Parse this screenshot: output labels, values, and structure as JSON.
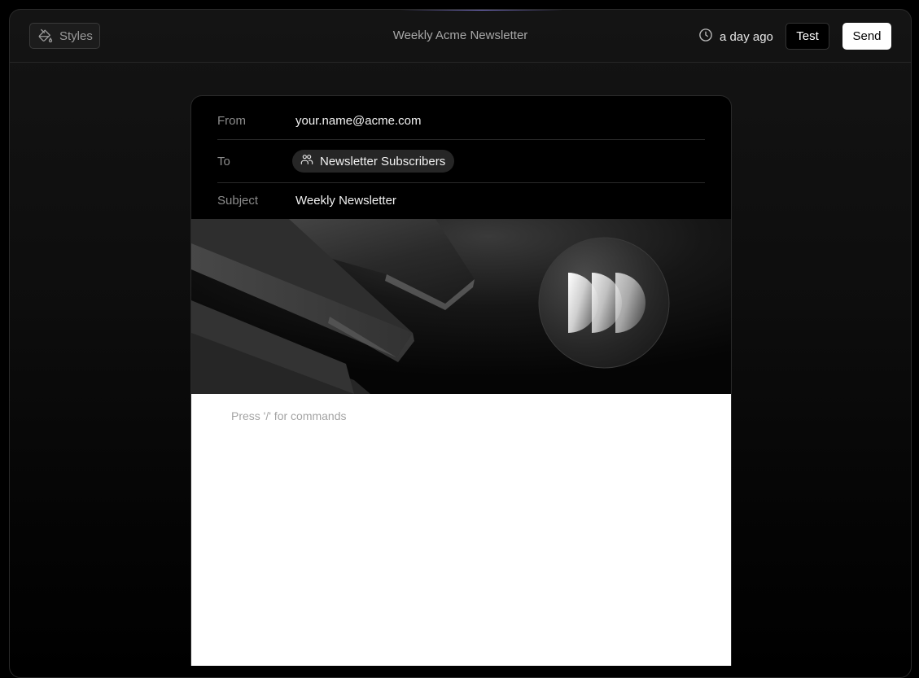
{
  "toolbar": {
    "styles_label": "Styles",
    "title": "Weekly Acme Newsletter",
    "saved_text": "a day ago",
    "test_label": "Test",
    "send_label": "Send"
  },
  "email": {
    "from_label": "From",
    "from_value": "your.name@acme.com",
    "to_label": "To",
    "to_value": "Newsletter Subscribers",
    "subject_label": "Subject",
    "subject_value": "Weekly Newsletter"
  },
  "editor": {
    "placeholder": "Press '/' for commands"
  },
  "icons": {
    "styles": "paint-bucket-icon",
    "saved": "clock-icon",
    "recipients": "users-icon",
    "banner_logo": "fast-forward-logo"
  },
  "colors": {
    "background": "#000000",
    "primary_button": "#ffffff",
    "accent_glow": "#9a8cff"
  }
}
